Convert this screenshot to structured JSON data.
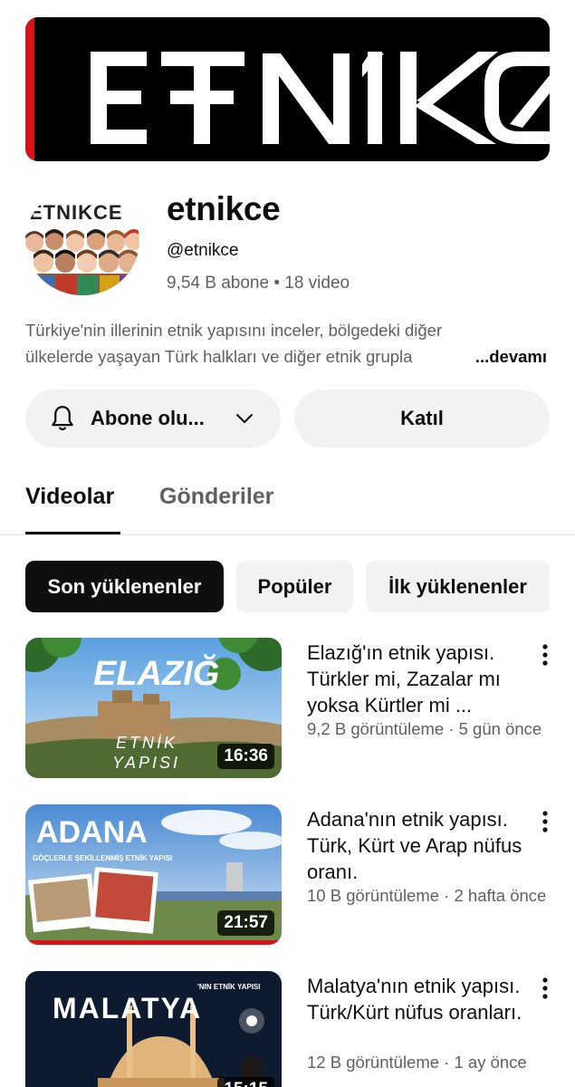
{
  "banner": {
    "text": "ETNIKCE"
  },
  "channel": {
    "avatar_text": "ETNIKCE",
    "name": "etnikce",
    "handle": "@etnikce",
    "meta": "9,54 B abone • 18 video",
    "description_line1": "Türkiye'nin illerinin etnik yapısını inceler, bölgedeki diğer",
    "description_line2": "ülkelerde yaşayan Türk halkları ve diğer etnik grupla",
    "more_label": "...devamı"
  },
  "actions": {
    "subscribe_label": "Abone olu...",
    "join_label": "Katıl"
  },
  "tabs": [
    {
      "label": "Videolar",
      "active": true
    },
    {
      "label": "Gönderiler",
      "active": false
    }
  ],
  "chips": [
    {
      "label": "Son yüklenenler",
      "active": true
    },
    {
      "label": "Popüler",
      "active": false
    },
    {
      "label": "İlk yüklenenler",
      "active": false
    }
  ],
  "videos": [
    {
      "title": "Elazığ'ın etnik yapısı. Türkler mi, Zazalar mı yoksa Kürtler mi ...",
      "meta": "9,2 B görüntüleme · 5 gün önce",
      "duration": "16:36",
      "thumb_title": "ELAZIĞ",
      "thumb_sub1": "ETNİK",
      "thumb_sub2": "YAPISI"
    },
    {
      "title": "Adana'nın etnik yapısı. Türk, Kürt ve Arap nüfus oranı.",
      "meta": "10 B görüntüleme · 2 hafta önce",
      "duration": "21:57",
      "thumb_title": "ADANA",
      "thumb_sub1": "GÖÇLERLE ŞEKİLLENMİŞ ETNİK YAPISI"
    },
    {
      "title": "Malatya'nın etnik yapısı. Türk/Kürt nüfus oranları.",
      "meta": "12 B görüntüleme · 1 ay önce",
      "duration": "15:15",
      "thumb_title": "MALATYA",
      "thumb_sub1": "'NIN ETNİK YAPISI"
    }
  ]
}
